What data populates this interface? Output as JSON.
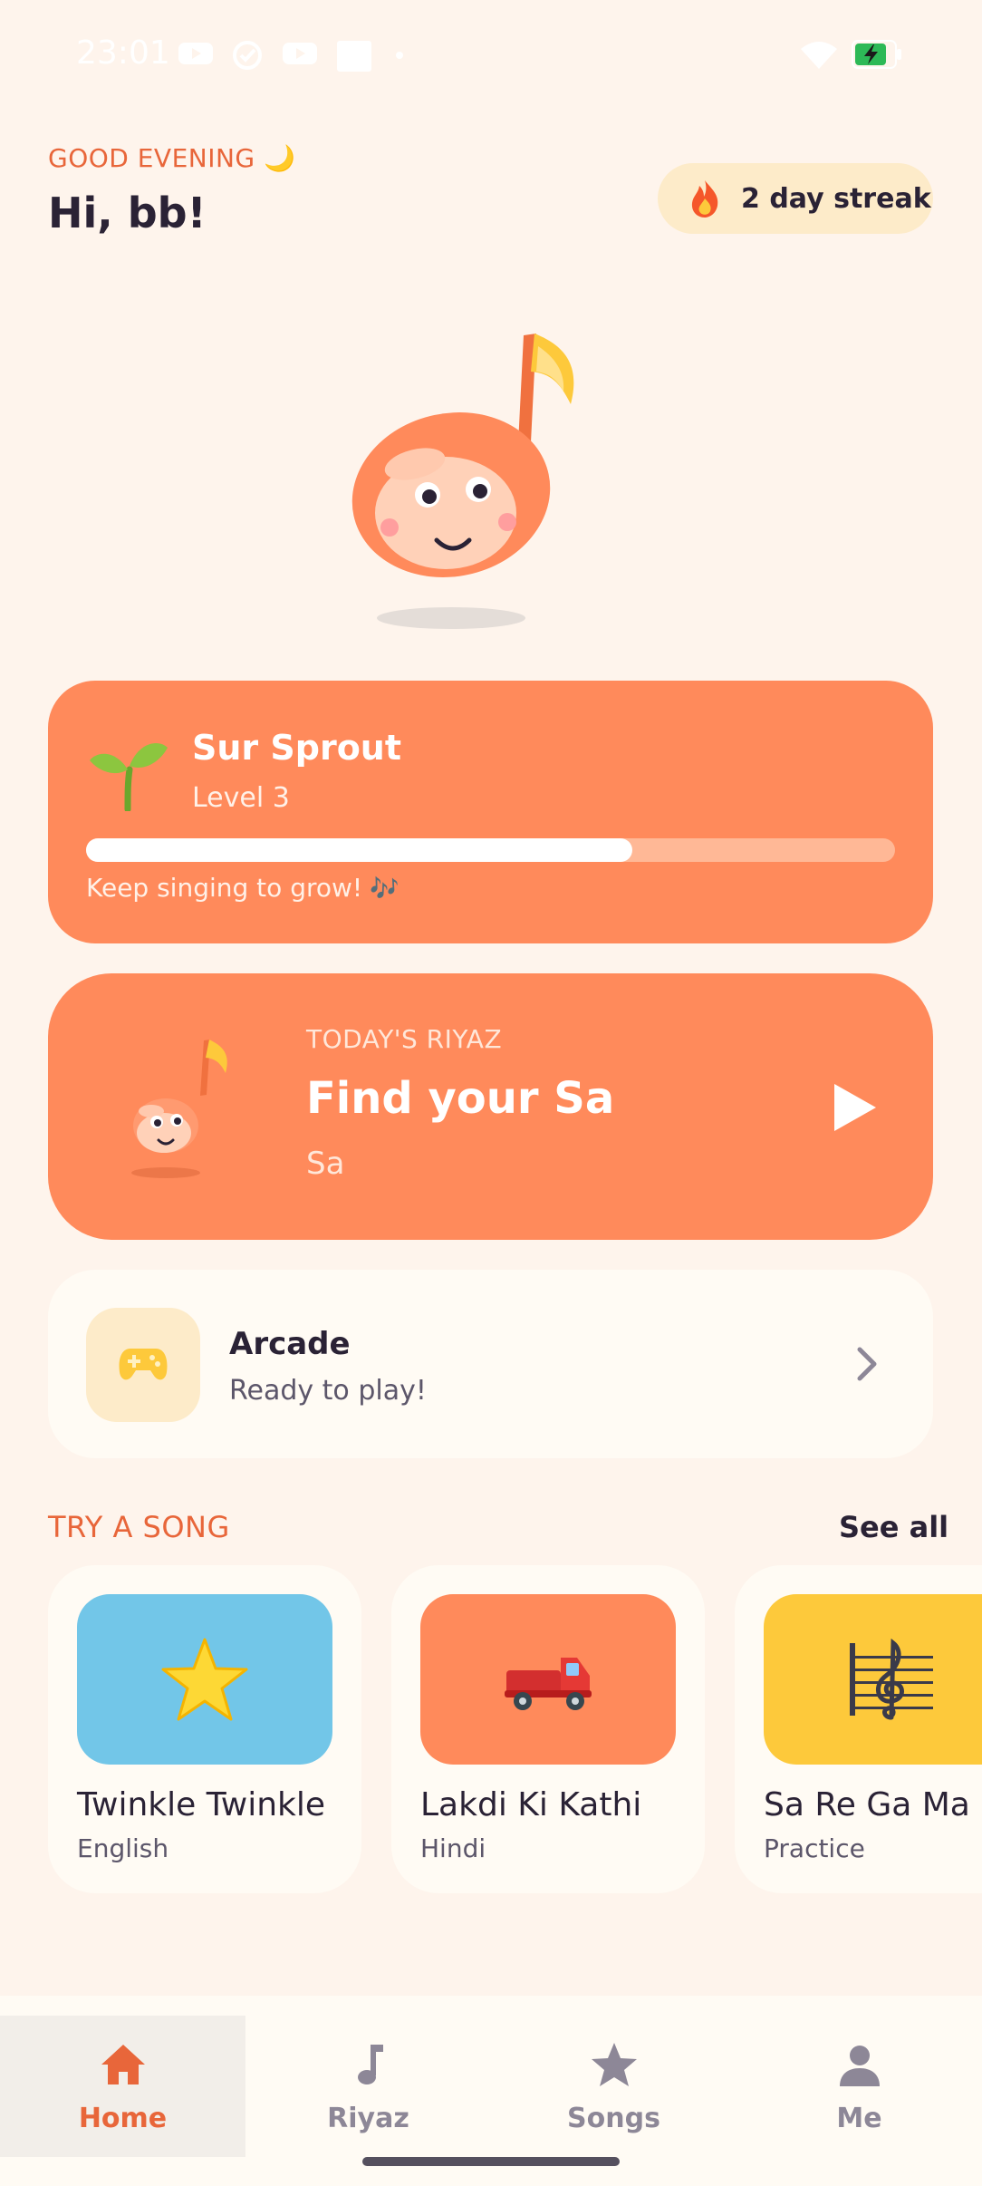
{
  "status_bar": {
    "time": "23:01",
    "notification_icons": [
      "youtube-icon",
      "check-circle-icon",
      "youtube-icon",
      "square-icon",
      "dot-icon"
    ],
    "system_icons": [
      "wifi-icon",
      "battery-charging-icon"
    ]
  },
  "header": {
    "greeting": "GOOD EVENING 🌙",
    "hello": "Hi, bb!",
    "streak": {
      "icon": "fire-icon",
      "label": "2 day streak"
    }
  },
  "level_card": {
    "icon": "sprout-icon",
    "title": "Sur Sprout",
    "level": "Level 3",
    "progress": 0.675,
    "hint": "Keep singing to grow!",
    "hint_icon": "🎶"
  },
  "riyaz_card": {
    "kicker": "TODAY'S RIYAZ",
    "title": "Find your Sa",
    "note": "Sa",
    "action_icon": "play-icon"
  },
  "arcade_card": {
    "icon": "gamepad-icon",
    "title": "Arcade",
    "subtitle": "Ready to play!",
    "action_icon": "chevron-right-icon"
  },
  "songs": {
    "section_title": "TRY A SONG",
    "see_all": "See all",
    "items": [
      {
        "title": "Twinkle Twinkle",
        "subtitle": "English",
        "icon": "star-icon",
        "color": "#72C6E8"
      },
      {
        "title": "Lakdi Ki Kathi",
        "subtitle": "Hindi",
        "icon": "truck-icon",
        "color": "#FF8A5B"
      },
      {
        "title": "Sa Re Ga Ma",
        "subtitle": "Practice",
        "icon": "music-staff-icon",
        "color": "#FDC93B"
      }
    ]
  },
  "bottom_nav": {
    "items": [
      {
        "label": "Home",
        "icon": "home-icon",
        "active": true
      },
      {
        "label": "Riyaz",
        "icon": "music-note-icon",
        "active": false
      },
      {
        "label": "Songs",
        "icon": "star-icon",
        "active": false
      },
      {
        "label": "Me",
        "icon": "person-icon",
        "active": false
      }
    ]
  },
  "colors": {
    "background": "#FEF4EC",
    "accent": "#FF8A5B",
    "accent_text": "#E8663A",
    "card": "#FFFBF4",
    "streak_bg": "#FDEBC9"
  }
}
